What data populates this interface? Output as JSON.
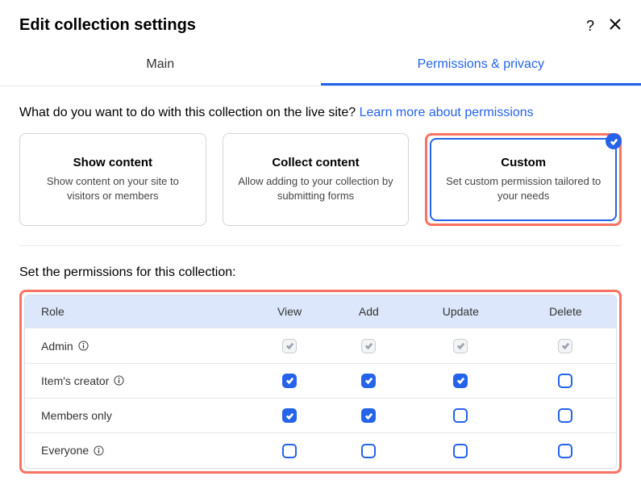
{
  "header": {
    "title": "Edit collection settings"
  },
  "tabs": [
    {
      "label": "Main",
      "active": false
    },
    {
      "label": "Permissions & privacy",
      "active": true
    }
  ],
  "prompt": {
    "text": "What do you want to do with this collection on the live site? ",
    "link": "Learn more about permissions"
  },
  "options": [
    {
      "title": "Show content",
      "desc": "Show content on your site to visitors or members",
      "selected": false,
      "highlighted": false
    },
    {
      "title": "Collect content",
      "desc": "Allow adding to your collection by submitting forms",
      "selected": false,
      "highlighted": false
    },
    {
      "title": "Custom",
      "desc": "Set custom permission tailored to your needs",
      "selected": true,
      "highlighted": true
    }
  ],
  "sectionLabel": "Set the permissions for this collection:",
  "table": {
    "columns": [
      "Role",
      "View",
      "Add",
      "Update",
      "Delete"
    ],
    "rows": [
      {
        "role": "Admin",
        "info": true,
        "cells": [
          "locked",
          "locked",
          "locked",
          "locked"
        ]
      },
      {
        "role": "Item's creator",
        "info": true,
        "cells": [
          "checked",
          "checked",
          "checked",
          "unchecked"
        ]
      },
      {
        "role": "Members only",
        "info": false,
        "cells": [
          "checked",
          "checked",
          "unchecked",
          "unchecked"
        ]
      },
      {
        "role": "Everyone",
        "info": true,
        "cells": [
          "unchecked",
          "unchecked",
          "unchecked",
          "unchecked"
        ]
      }
    ]
  }
}
